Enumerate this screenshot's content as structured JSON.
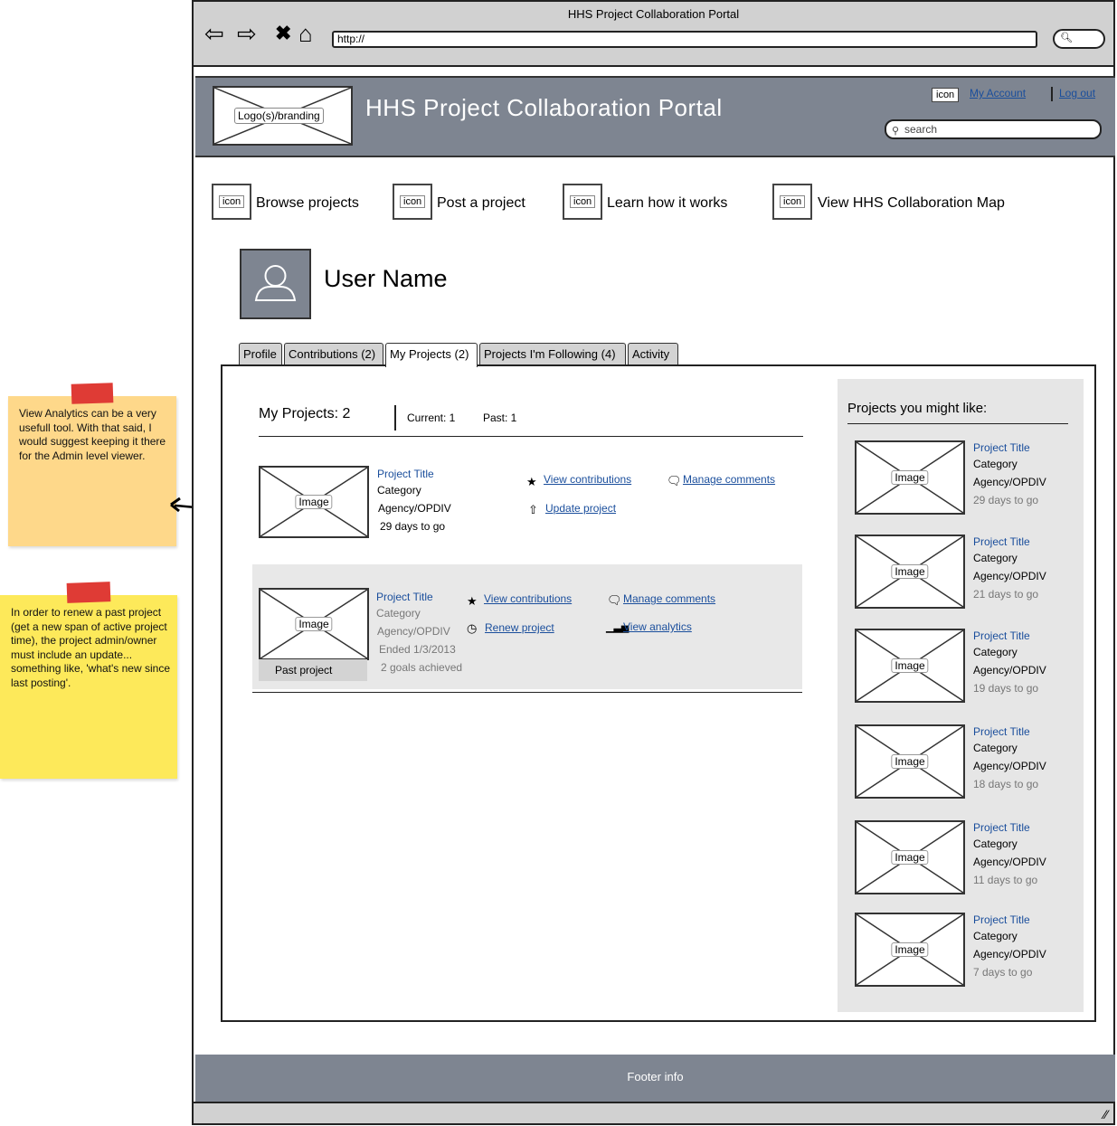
{
  "notes": [
    {
      "text": "View Analytics can be a very usefull tool. With that said, I would suggest keeping it there for the Admin level viewer."
    },
    {
      "text": "In order to renew a past project (get a new span of active project time), the project admin/owner must include an update... something like, 'what's new since last posting'."
    }
  ],
  "browser": {
    "window_title": "HHS Project Collaboration Portal",
    "url": "http://",
    "nav_icons": [
      "back-arrow-icon",
      "forward-arrow-icon",
      "stop-x-icon",
      "home-icon"
    ]
  },
  "header": {
    "logo_label": "Logo(s)/branding",
    "title": "HHS Project Collaboration Portal",
    "account_icon_label": "icon",
    "my_account": "My Account",
    "log_out": "Log out",
    "search_placeholder": "search"
  },
  "quick_nav": [
    {
      "icon_label": "icon",
      "label": "Browse projects"
    },
    {
      "icon_label": "icon",
      "label": "Post a project"
    },
    {
      "icon_label": "icon",
      "label": "Learn how it works"
    },
    {
      "icon_label": "icon",
      "label": "View HHS Collaboration Map"
    }
  ],
  "profile": {
    "user_name": "User Name"
  },
  "tabs": [
    {
      "label": "Profile"
    },
    {
      "label": "Contributions (2)"
    },
    {
      "label": "My Projects (2)",
      "active": true
    },
    {
      "label": "Projects I'm Following (4)"
    },
    {
      "label": "Activity"
    }
  ],
  "my_projects": {
    "heading": "My Projects: 2",
    "current": "Current:  1",
    "past": "Past: 1",
    "current_project": {
      "image_label": "Image",
      "title": "Project Title",
      "category": "Category",
      "agency": "Agency/OPDIV",
      "days": "29 days to go",
      "actions": [
        "View contributions",
        "Manage comments",
        "Update project"
      ]
    },
    "past_project": {
      "image_label": "Image",
      "badge": "Past project",
      "title": "Project Title",
      "category": "Category",
      "agency": "Agency/OPDIV",
      "ended": "Ended 1/3/2013",
      "goals": "2 goals achieved",
      "actions": [
        "View contributions",
        "Manage comments",
        "Renew project",
        "View analytics"
      ]
    }
  },
  "suggestions": {
    "heading": "Projects you might like:",
    "items": [
      {
        "image_label": "Image",
        "title": "Project Title",
        "category": "Category",
        "agency": "Agency/OPDIV",
        "days": "29 days to go"
      },
      {
        "image_label": "Image",
        "title": "Project Title",
        "category": "Category",
        "agency": "Agency/OPDIV",
        "days": "21 days to go"
      },
      {
        "image_label": "Image",
        "title": "Project Title",
        "category": "Category",
        "agency": "Agency/OPDIV",
        "days": "19 days to go"
      },
      {
        "image_label": "Image",
        "title": "Project Title",
        "category": "Category",
        "agency": "Agency/OPDIV",
        "days": "18 days to go"
      },
      {
        "image_label": "Image",
        "title": "Project Title",
        "category": "Category",
        "agency": "Agency/OPDIV",
        "days": "11 days to go"
      },
      {
        "image_label": "Image",
        "title": "Project Title",
        "category": "Category",
        "agency": "Agency/OPDIV",
        "days": "7 days to go"
      }
    ]
  },
  "footer": {
    "text": "Footer info"
  }
}
